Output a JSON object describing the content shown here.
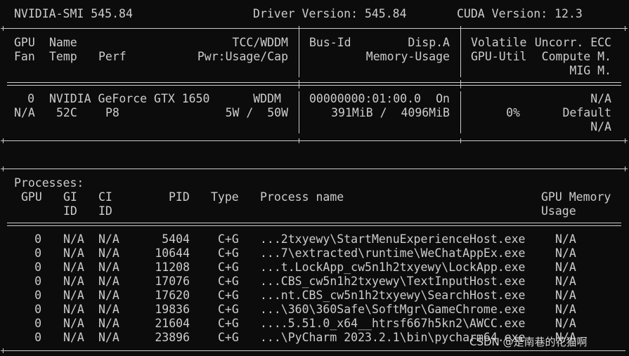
{
  "header": {
    "smi_version": "NVIDIA-SMI 545.84",
    "driver_version": "Driver Version: 545.84",
    "cuda_version": "CUDA Version: 12.3"
  },
  "gpu_table": {
    "col_headers": {
      "gpu": "GPU",
      "name": "Name",
      "tcc_wddm": "TCC/WDDM",
      "fan": "Fan",
      "temp": "Temp",
      "perf": "Perf",
      "pwr": "Pwr:Usage/Cap",
      "bus_id": "Bus-Id",
      "disp_a": "Disp.A",
      "memory_usage": "Memory-Usage",
      "volatile": "Volatile",
      "uncorr_ecc": "Uncorr. ECC",
      "gpu_util": "GPU-Util",
      "compute_m": "Compute M.",
      "mig_m": "MIG M."
    },
    "gpus": [
      {
        "index": "0",
        "name": "NVIDIA GeForce GTX 1650",
        "mode": "WDDM",
        "bus_id": "00000000:01:00.0",
        "disp": "On",
        "ecc": "N/A",
        "fan": "N/A",
        "temp": "52C",
        "perf": "P8",
        "power": "5W /  50W",
        "memory": "391MiB /  4096MiB",
        "util": "0%",
        "compute_mode": "Default",
        "mig_mode": "N/A"
      }
    ]
  },
  "processes": {
    "title": "Processes:",
    "headers": {
      "gpu": "GPU",
      "gi": "GI",
      "gi2": "ID",
      "ci": "CI",
      "ci2": "ID",
      "pid": "PID",
      "type": "Type",
      "name": "Process name",
      "mem": "GPU Memory",
      "mem2": "Usage"
    },
    "rows": [
      {
        "gpu": "0",
        "gi": "N/A",
        "ci": "N/A",
        "pid": "5404",
        "type": "C+G",
        "name": "...2txyewy\\StartMenuExperienceHost.exe",
        "mem": "N/A"
      },
      {
        "gpu": "0",
        "gi": "N/A",
        "ci": "N/A",
        "pid": "10644",
        "type": "C+G",
        "name": "...7\\extracted\\runtime\\WeChatAppEx.exe",
        "mem": "N/A"
      },
      {
        "gpu": "0",
        "gi": "N/A",
        "ci": "N/A",
        "pid": "11208",
        "type": "C+G",
        "name": "...t.LockApp_cw5n1h2txyewy\\LockApp.exe",
        "mem": "N/A"
      },
      {
        "gpu": "0",
        "gi": "N/A",
        "ci": "N/A",
        "pid": "17076",
        "type": "C+G",
        "name": "...CBS_cw5n1h2txyewy\\TextInputHost.exe",
        "mem": "N/A"
      },
      {
        "gpu": "0",
        "gi": "N/A",
        "ci": "N/A",
        "pid": "17620",
        "type": "C+G",
        "name": "...nt.CBS_cw5n1h2txyewy\\SearchHost.exe",
        "mem": "N/A"
      },
      {
        "gpu": "0",
        "gi": "N/A",
        "ci": "N/A",
        "pid": "19836",
        "type": "C+G",
        "name": "...\\360\\360Safe\\SoftMgr\\GameChrome.exe",
        "mem": "N/A"
      },
      {
        "gpu": "0",
        "gi": "N/A",
        "ci": "N/A",
        "pid": "21604",
        "type": "C+G",
        "name": "....5.51.0_x64__htrsf667h5kn2\\AWCC.exe",
        "mem": "N/A"
      },
      {
        "gpu": "0",
        "gi": "N/A",
        "ci": "N/A",
        "pid": "23896",
        "type": "C+G",
        "name": "...\\PyCharm 2023.2.1\\bin\\pycharm64.exe",
        "mem": "N/A"
      }
    ]
  },
  "watermark": "CSDN @是南巷的花猫啊",
  "colors": {
    "background": "#0c0c0c",
    "text": "#cccccc"
  }
}
